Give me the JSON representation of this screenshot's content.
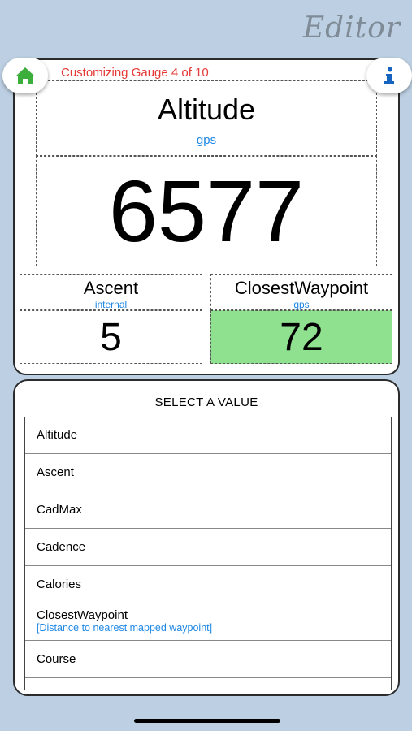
{
  "header": {
    "title": "Editor"
  },
  "gauge_editor": {
    "status": "Customizing Gauge 4 of 10",
    "main": {
      "title": "Altitude",
      "source": "gps",
      "value": "6577"
    },
    "left": {
      "title": "Ascent",
      "source": "internal",
      "value": "5"
    },
    "right": {
      "title": "ClosestWaypoint",
      "source": "gps",
      "value": "72",
      "highlight": "#8fe08f"
    }
  },
  "select_panel": {
    "heading": "SELECT A VALUE",
    "items": [
      {
        "label": "Altitude"
      },
      {
        "label": "Ascent"
      },
      {
        "label": "CadMax"
      },
      {
        "label": "Cadence"
      },
      {
        "label": "Calories"
      },
      {
        "label": "ClosestWaypoint",
        "description": "[Distance to nearest mapped waypoint]"
      },
      {
        "label": "Course"
      }
    ]
  },
  "icons": {
    "home": "home-icon",
    "info": "info-icon"
  },
  "colors": {
    "background": "#bdd0e3",
    "accent": "#1e88e5",
    "status": "#e53935",
    "home": "#3cae3c"
  }
}
